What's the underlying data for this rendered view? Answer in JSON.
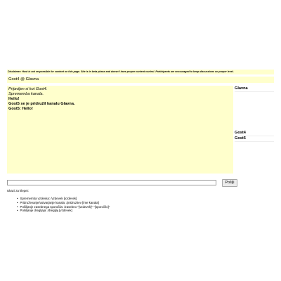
{
  "disclaimer": "Disclaimer: Host is not responsible for content on this page. Site is in beta phase and doesn't have proper content control. Participants are encouraged to keep discussions on proper level.",
  "channel_bar": "Gost4 @ Glavna",
  "chat": {
    "lines": [
      {
        "text": "Prijavljen si kot Gost4.",
        "style": "sys"
      },
      {
        "text": "Sprememba kanala.",
        "style": "sys"
      },
      {
        "text": "Hello!",
        "style": "bold"
      },
      {
        "text": "Gost5 se je pridružil kanalu Glavna.",
        "style": "bold"
      },
      {
        "text": "Gost5: Hello!",
        "style": "bold"
      }
    ]
  },
  "side": {
    "channel": "Glavna",
    "users": [
      "Gost4",
      "Gost5"
    ]
  },
  "input": {
    "value": "",
    "send_label": "Pošlji"
  },
  "help": {
    "title": "Ukazi za klepet:",
    "items": [
      "Sprememba vzdevka: /vzdevek [vzdevek]",
      "Pridruževanje/ustvarjanje kanala: /pridruzitev [ime kanala]",
      "Pošiljanje zasebnega sporočila: /zasebno \"[vzdevek]\" \"[sporočilo]\"",
      "Pošiljanje dregljaja: /dregljaj [vzdevek]"
    ]
  }
}
